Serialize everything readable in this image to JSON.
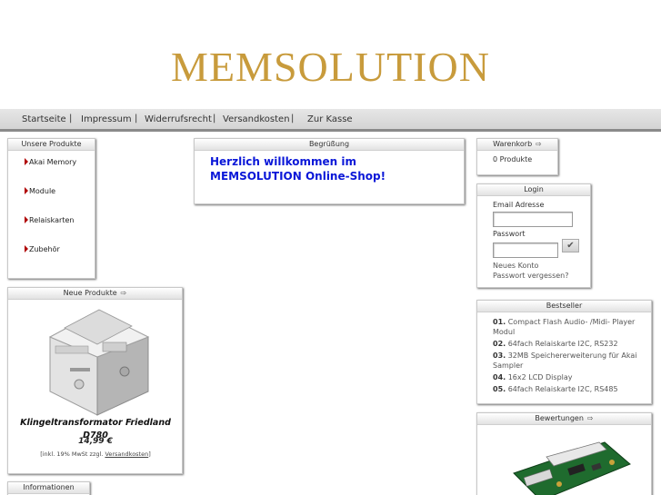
{
  "logo": {
    "text": "MEMSOLUTION"
  },
  "nav": {
    "items": [
      "Startseite",
      "Impressum",
      "Widerrufsrecht",
      "Versandkosten",
      "Zur Kasse"
    ],
    "separator": "|"
  },
  "products_box": {
    "title": "Unsere Produkte",
    "categories": [
      "Akai Memory",
      "Module",
      "Relaiskarten",
      "Zubehör"
    ]
  },
  "new_products": {
    "title": "Neue Produkte",
    "product_name": "Klingeltransformator Friedland D780",
    "price": "14,99 €",
    "tax_prefix": "[inkl. 19% MwSt zzgl. ",
    "tax_link": "Versandkosten",
    "tax_suffix": "]"
  },
  "info_box": {
    "title": "Informationen"
  },
  "welcome_box": {
    "title": "Begrüßung",
    "text": "Herzlich willkommen im MEMSOLUTION Online-Shop!"
  },
  "cart_box": {
    "title": "Warenkorb",
    "content": "0 Produkte"
  },
  "login_box": {
    "title": "Login",
    "email_label": "Email Adresse",
    "password_label": "Passwort",
    "submit_icon": "checkmark-icon",
    "new_account": "Neues Konto",
    "forgot_password": "Passwort vergessen?"
  },
  "bestseller_box": {
    "title": "Bestseller",
    "items": [
      {
        "num": "01.",
        "text": "Compact Flash Audio- /Midi- Player Modul"
      },
      {
        "num": "02.",
        "text": "64fach Relaiskarte I2C, RS232"
      },
      {
        "num": "03.",
        "text": "32MB Speichererweiterung für Akai Sampler"
      },
      {
        "num": "04.",
        "text": "16x2 LCD Display"
      },
      {
        "num": "05.",
        "text": "64fach Relaiskarte I2C, RS485"
      }
    ]
  },
  "reviews_box": {
    "title": "Bewertungen"
  },
  "icons": {
    "box_arrow": "arrow-right-icon",
    "category_bullet": "triangle-bullet-icon"
  },
  "colors": {
    "logo": "#c89b3c",
    "welcome_text": "#0a17d8",
    "bullet": "#b00000"
  }
}
